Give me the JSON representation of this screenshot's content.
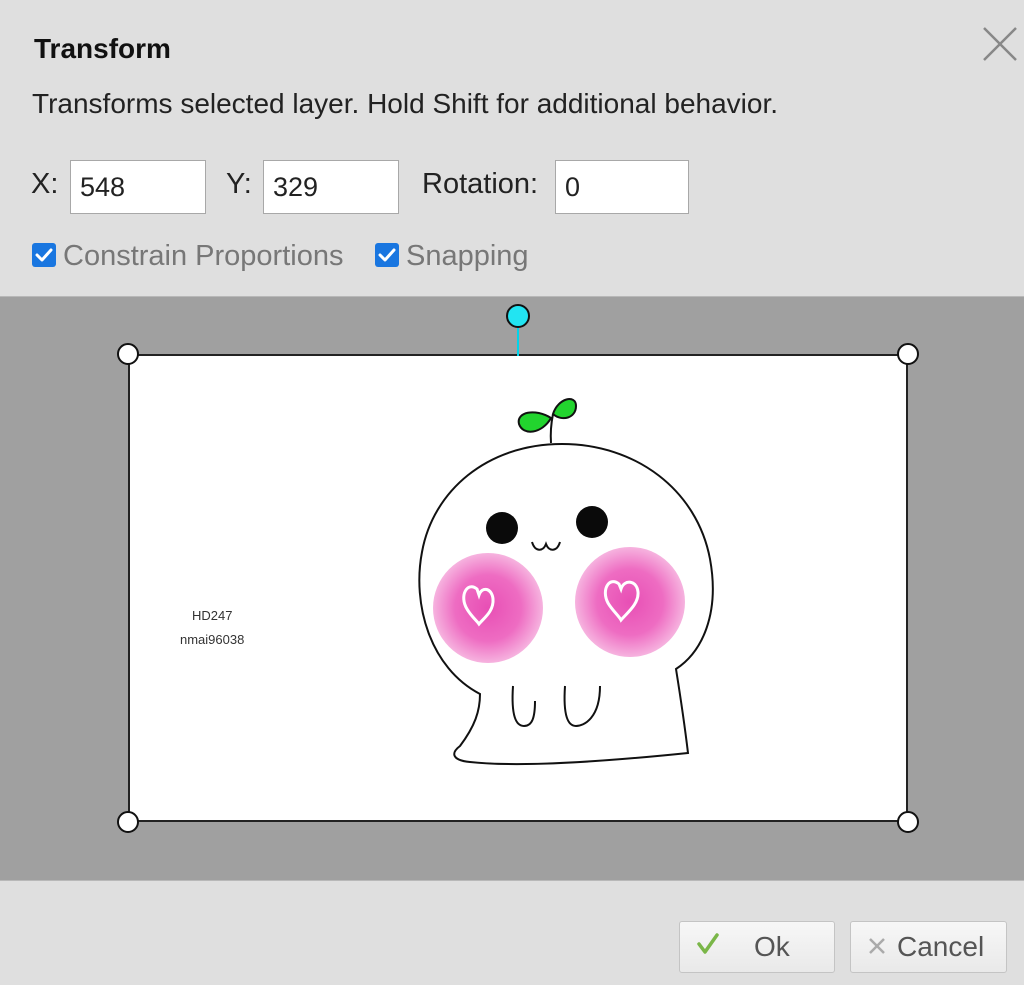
{
  "dialog": {
    "title": "Transform",
    "description": "Transforms selected layer. Hold Shift for additional behavior."
  },
  "fields": {
    "x_label": "X:",
    "x_value": "548",
    "y_label": "Y:",
    "y_value": "329",
    "rotation_label": "Rotation:",
    "rotation_value": "0"
  },
  "options": {
    "constrain_label": "Constrain Proportions",
    "constrain_checked": true,
    "snapping_label": "Snapping",
    "snapping_checked": true
  },
  "layer": {
    "watermark_line1": "HD247",
    "watermark_line2": "nmai96038"
  },
  "buttons": {
    "ok_label": "Ok",
    "cancel_label": "Cancel"
  },
  "icons": {
    "close": "close-icon",
    "ok": "checkmark-icon",
    "cancel": "x-icon",
    "checkbox": "checkbox-checked-icon"
  },
  "colors": {
    "accent_check": "#1976e0",
    "ok_icon": "#7ab648",
    "rotation_handle": "#22e4f2",
    "canvas_background": "#a0a0a0",
    "dialog_background": "#dfdfdf"
  }
}
